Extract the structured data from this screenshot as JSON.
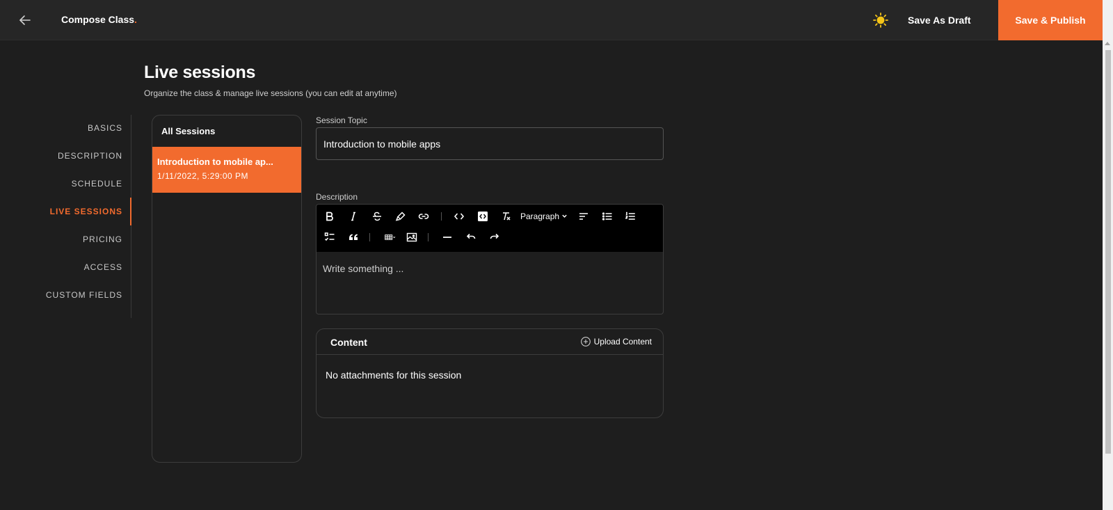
{
  "header": {
    "title": "Compose Class",
    "title_suffix": ".",
    "save_draft_label": "Save As Draft",
    "publish_label": "Save & Publish"
  },
  "page": {
    "title": "Live sessions",
    "subtitle": "Organize the class & manage live sessions (you can edit at anytime)"
  },
  "nav": {
    "items": [
      {
        "label": "BASICS"
      },
      {
        "label": "DESCRIPTION"
      },
      {
        "label": "SCHEDULE"
      },
      {
        "label": "LIVE SESSIONS",
        "active": true
      },
      {
        "label": "PRICING"
      },
      {
        "label": "ACCESS"
      },
      {
        "label": "CUSTOM FIELDS"
      }
    ]
  },
  "sessions": {
    "header": "All Sessions",
    "items": [
      {
        "title": "Introduction to mobile ap...",
        "date": "1/11/2022, 5:29:00 PM",
        "selected": true
      }
    ]
  },
  "form": {
    "topic_label": "Session Topic",
    "topic_value": "Introduction to mobile apps",
    "description_label": "Description",
    "description_placeholder": "Write something ...",
    "paragraph_label": "Paragraph"
  },
  "content": {
    "title": "Content",
    "upload_label": "Upload Content",
    "empty_text": "No attachments for this session"
  },
  "colors": {
    "accent": "#f26b2e",
    "background": "#1e1e1e",
    "topbar": "#262626",
    "sun_icon": "#f5c518"
  }
}
